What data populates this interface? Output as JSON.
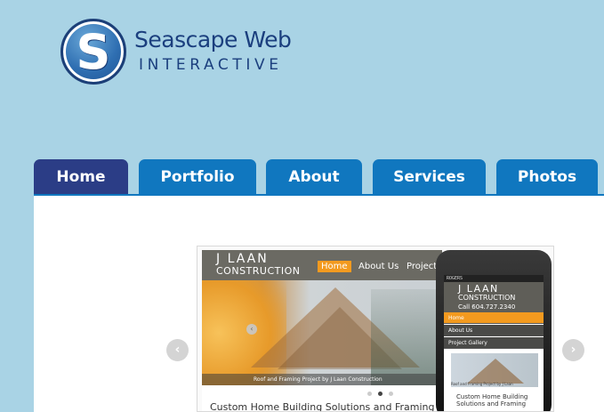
{
  "brand": {
    "logo_letter": "S",
    "name": "Seascape Web",
    "tagline": "INTERACTIVE"
  },
  "nav": {
    "items": [
      {
        "label": "Home",
        "active": true
      },
      {
        "label": "Portfolio",
        "active": false
      },
      {
        "label": "About",
        "active": false
      },
      {
        "label": "Services",
        "active": false
      },
      {
        "label": "Photos",
        "active": false
      }
    ]
  },
  "slider": {
    "prev_label": "‹",
    "next_label": "›",
    "desktop": {
      "brand_line1": "J LAAN",
      "brand_line2": "CONSTRUCTION",
      "nav": [
        "Home",
        "About Us",
        "Project"
      ],
      "prev_label": "‹",
      "caption": "Roof and Framing Project by J Laan Construction",
      "heading": "Custom Home Building Solutions and Framing",
      "active_dot": 2,
      "dot_count": 3
    },
    "phone": {
      "status": "ROGERS",
      "brand_line1": "J LAAN",
      "brand_line2": "CONSTRUCTION",
      "call": "Call 604.727.2340",
      "menu": [
        "Home",
        "About Us",
        "Project Gallery"
      ],
      "caption": "Roof and Framing Project by J Laan",
      "heading": "Custom Home Building Solutions and Framing"
    }
  },
  "colors": {
    "background": "#a9d3e5",
    "nav_tab": "#1077bf",
    "nav_active": "#2b3d86",
    "brand_text": "#1b3f7e",
    "accent_orange": "#f39a1f"
  }
}
